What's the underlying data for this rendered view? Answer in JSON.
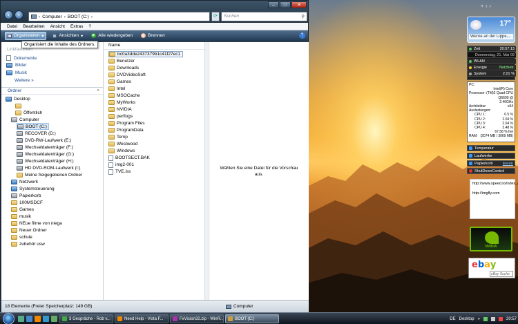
{
  "window": {
    "address": {
      "root": "Computer",
      "current": "BOOT (C:)"
    },
    "search_placeholder": "Suchen",
    "caption": {
      "min": "–",
      "max": "□",
      "close": "✕"
    }
  },
  "menu": [
    "Datei",
    "Bearbeiten",
    "Ansicht",
    "Extras",
    "?"
  ],
  "toolbar": {
    "organize": "Organisieren",
    "views": "Ansichten",
    "play": "Alle wiedergeben",
    "burn": "Brennen",
    "tooltip": "Organisiert die Inhalte des Ordners."
  },
  "leftpane": {
    "links_title": "Linkfavoriten",
    "links": [
      "Dokumente",
      "Bilder",
      "Musik"
    ],
    "more": "Weitere",
    "more_arrow": "»",
    "folders_title": "Ordner",
    "tree": [
      "Desktop",
      "",
      "Öffentlich",
      "Computer",
      "BOOT (C:)",
      "RECOVER (D:)",
      "DVD-RW-Laufwerk (E:)",
      "Wechseldatenträger (F:)",
      "Wechseldatenträger (G:)",
      "Wechseldatenträger (H:)",
      "HD DVD-ROM-Laufwerk (I:)",
      "Meine freigegebenen Ordner",
      "Netzwerk",
      "Systemsteuerung",
      "Papierkorb",
      "100MSDCF",
      "Games",
      "musik",
      "NEue filme von niega",
      "Neuer Ordner",
      "schule",
      "zubehör usw"
    ]
  },
  "mainpane": {
    "column": "Name",
    "files": [
      "bc0a3dde2437379b1c41f27ec1",
      "Benutzer",
      "Downloads",
      "DVDVideoSoft",
      "Games",
      "Intel",
      "MSOCache",
      "MyWorks",
      "NVIDIA",
      "perflogs",
      "Program Files",
      "ProgramData",
      "Temp",
      "Westwood",
      "Windows",
      "BOOTSECT.BAK",
      "img2-001",
      "TVE.iss"
    ]
  },
  "preview": {
    "message": "Wählen Sie eine Datei für die Vorschau aus."
  },
  "status": {
    "count": "18 Elemente (Freier Speicherplatz: 149 GB)",
    "location": "Computer"
  },
  "gadgets": {
    "weather": {
      "temp": "17°",
      "city": "Werne an der Lippe,..."
    },
    "clock": {
      "label": "Zeit",
      "time": "20:57:13",
      "date": "Donnerstag, 21. Mai 09"
    },
    "wlan": "WLAN",
    "energy": {
      "label": "Energie",
      "value": "Netzbetr."
    },
    "system": {
      "label": "System",
      "value": "2.01 %"
    },
    "sysinfo": {
      "pc": "PC:",
      "cpu_name": "Intel(R) Core (TM)2 Quad CPU Q6600 @ 2.40GHz",
      "prozessor_label": "Prozessor:",
      "arch_label": "Architektur:",
      "arch": "x64",
      "load_label": "Auslastungen:",
      "cpus": [
        {
          "name": "CPU 1:",
          "value": "0.5 %"
        },
        {
          "name": "CPU 2:",
          "value": "2.04 %"
        },
        {
          "name": "CPU 3:",
          "value": "2.04 %"
        },
        {
          "name": "CPU 4:",
          "value": "3.48 %"
        }
      ],
      "ram_free": "67.58 % frei",
      "ram_label": "RAM:",
      "ram": "(2074 MB / 3069 MB)"
    },
    "temperatur": "Temperatur",
    "laufwerke": "Laufwerke",
    "papierkorb": {
      "label": "Papierkorb",
      "action": "leeren"
    },
    "shutdown": "ShutDownControl",
    "notes": [
      "http://www.speed.io/index_de.html",
      "http://imgfly.com"
    ],
    "nvidia": "NVIDIA",
    "ebay": {
      "letters": [
        "e",
        "b",
        "a",
        "y"
      ],
      "search": "eBay Suche"
    }
  },
  "taskbar": {
    "buttons": [
      "3 Gespräche - Rob v...",
      "Need Help - Vista F...",
      "FxVision32.zip - WinR...",
      "BOOT (C:)"
    ],
    "tray": {
      "lang": "DE",
      "desktop": "Desktop",
      "time": "20:57"
    }
  },
  "colors": {
    "toolbar": "#223a54",
    "link": "#1a4a8a",
    "nvidia_green": "#76b900",
    "ebay": [
      "#e53238",
      "#0064d2",
      "#f5af02",
      "#86b817"
    ]
  }
}
